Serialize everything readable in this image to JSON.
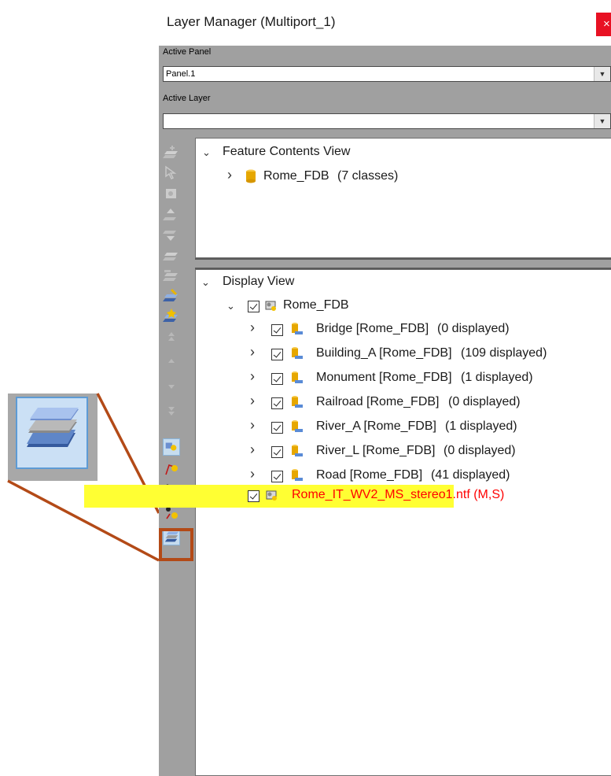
{
  "window": {
    "title": "Layer Manager (Multiport_1)",
    "close_glyph": "×"
  },
  "active_panel": {
    "label": "Active Panel",
    "value": "Panel.1"
  },
  "active_layer": {
    "label": "Active Layer",
    "value": ""
  },
  "combo_arrow": "▼",
  "feature_view": {
    "title": "Feature Contents View",
    "db": "Rome_FDB",
    "db_count": "(7 classes)"
  },
  "display_view": {
    "title": "Display View",
    "root": "Rome_FDB",
    "layers": [
      {
        "name": "Bridge [Rome_FDB]",
        "count": "(0 displayed)"
      },
      {
        "name": "Building_A [Rome_FDB]",
        "count": "(109 displayed)"
      },
      {
        "name": "Monument [Rome_FDB]",
        "count": "(1 displayed)"
      },
      {
        "name": "Railroad [Rome_FDB]",
        "count": "(0 displayed)"
      },
      {
        "name": "River_A [Rome_FDB]",
        "count": "(1 displayed)"
      },
      {
        "name": "River_L [Rome_FDB]",
        "count": "(0 displayed)"
      },
      {
        "name": "Road [Rome_FDB]",
        "count": "(41 displayed)"
      }
    ],
    "image_layer": "Rome_IT_WV2_MS_stereo1.ntf (M,S)"
  },
  "chevrons": {
    "open": "⌄",
    "closed": "›"
  },
  "colors": {
    "highlight": "#ffff33",
    "image_layer_text": "#ff0000",
    "callout": "#b34a17",
    "close": "#e81123"
  },
  "icons": [
    "layer-stack-icon",
    "database-icon",
    "feature-class-icon",
    "image-layer-icon"
  ]
}
